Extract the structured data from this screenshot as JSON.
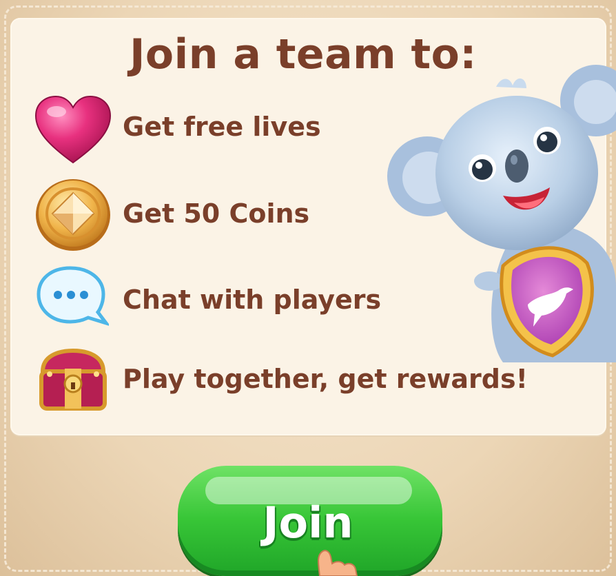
{
  "dialog": {
    "title": "Join a team to:",
    "features": [
      {
        "label": "Get free lives",
        "icon": "heart-icon"
      },
      {
        "label": "Get 50 Coins",
        "icon": "coin-icon"
      },
      {
        "label": "Chat with players",
        "icon": "chat-bubble-icon"
      },
      {
        "label": "Play together, get rewards!",
        "icon": "treasure-chest-icon"
      }
    ],
    "mascot": "koala-mascot",
    "badge_icon": "bird-badge-icon",
    "join_label": "Join"
  },
  "colors": {
    "title_text": "#7a3f2a",
    "panel_bg": "#fbf3e6",
    "frame_bg": "#ecd6b6",
    "join_green": "#38c637"
  }
}
